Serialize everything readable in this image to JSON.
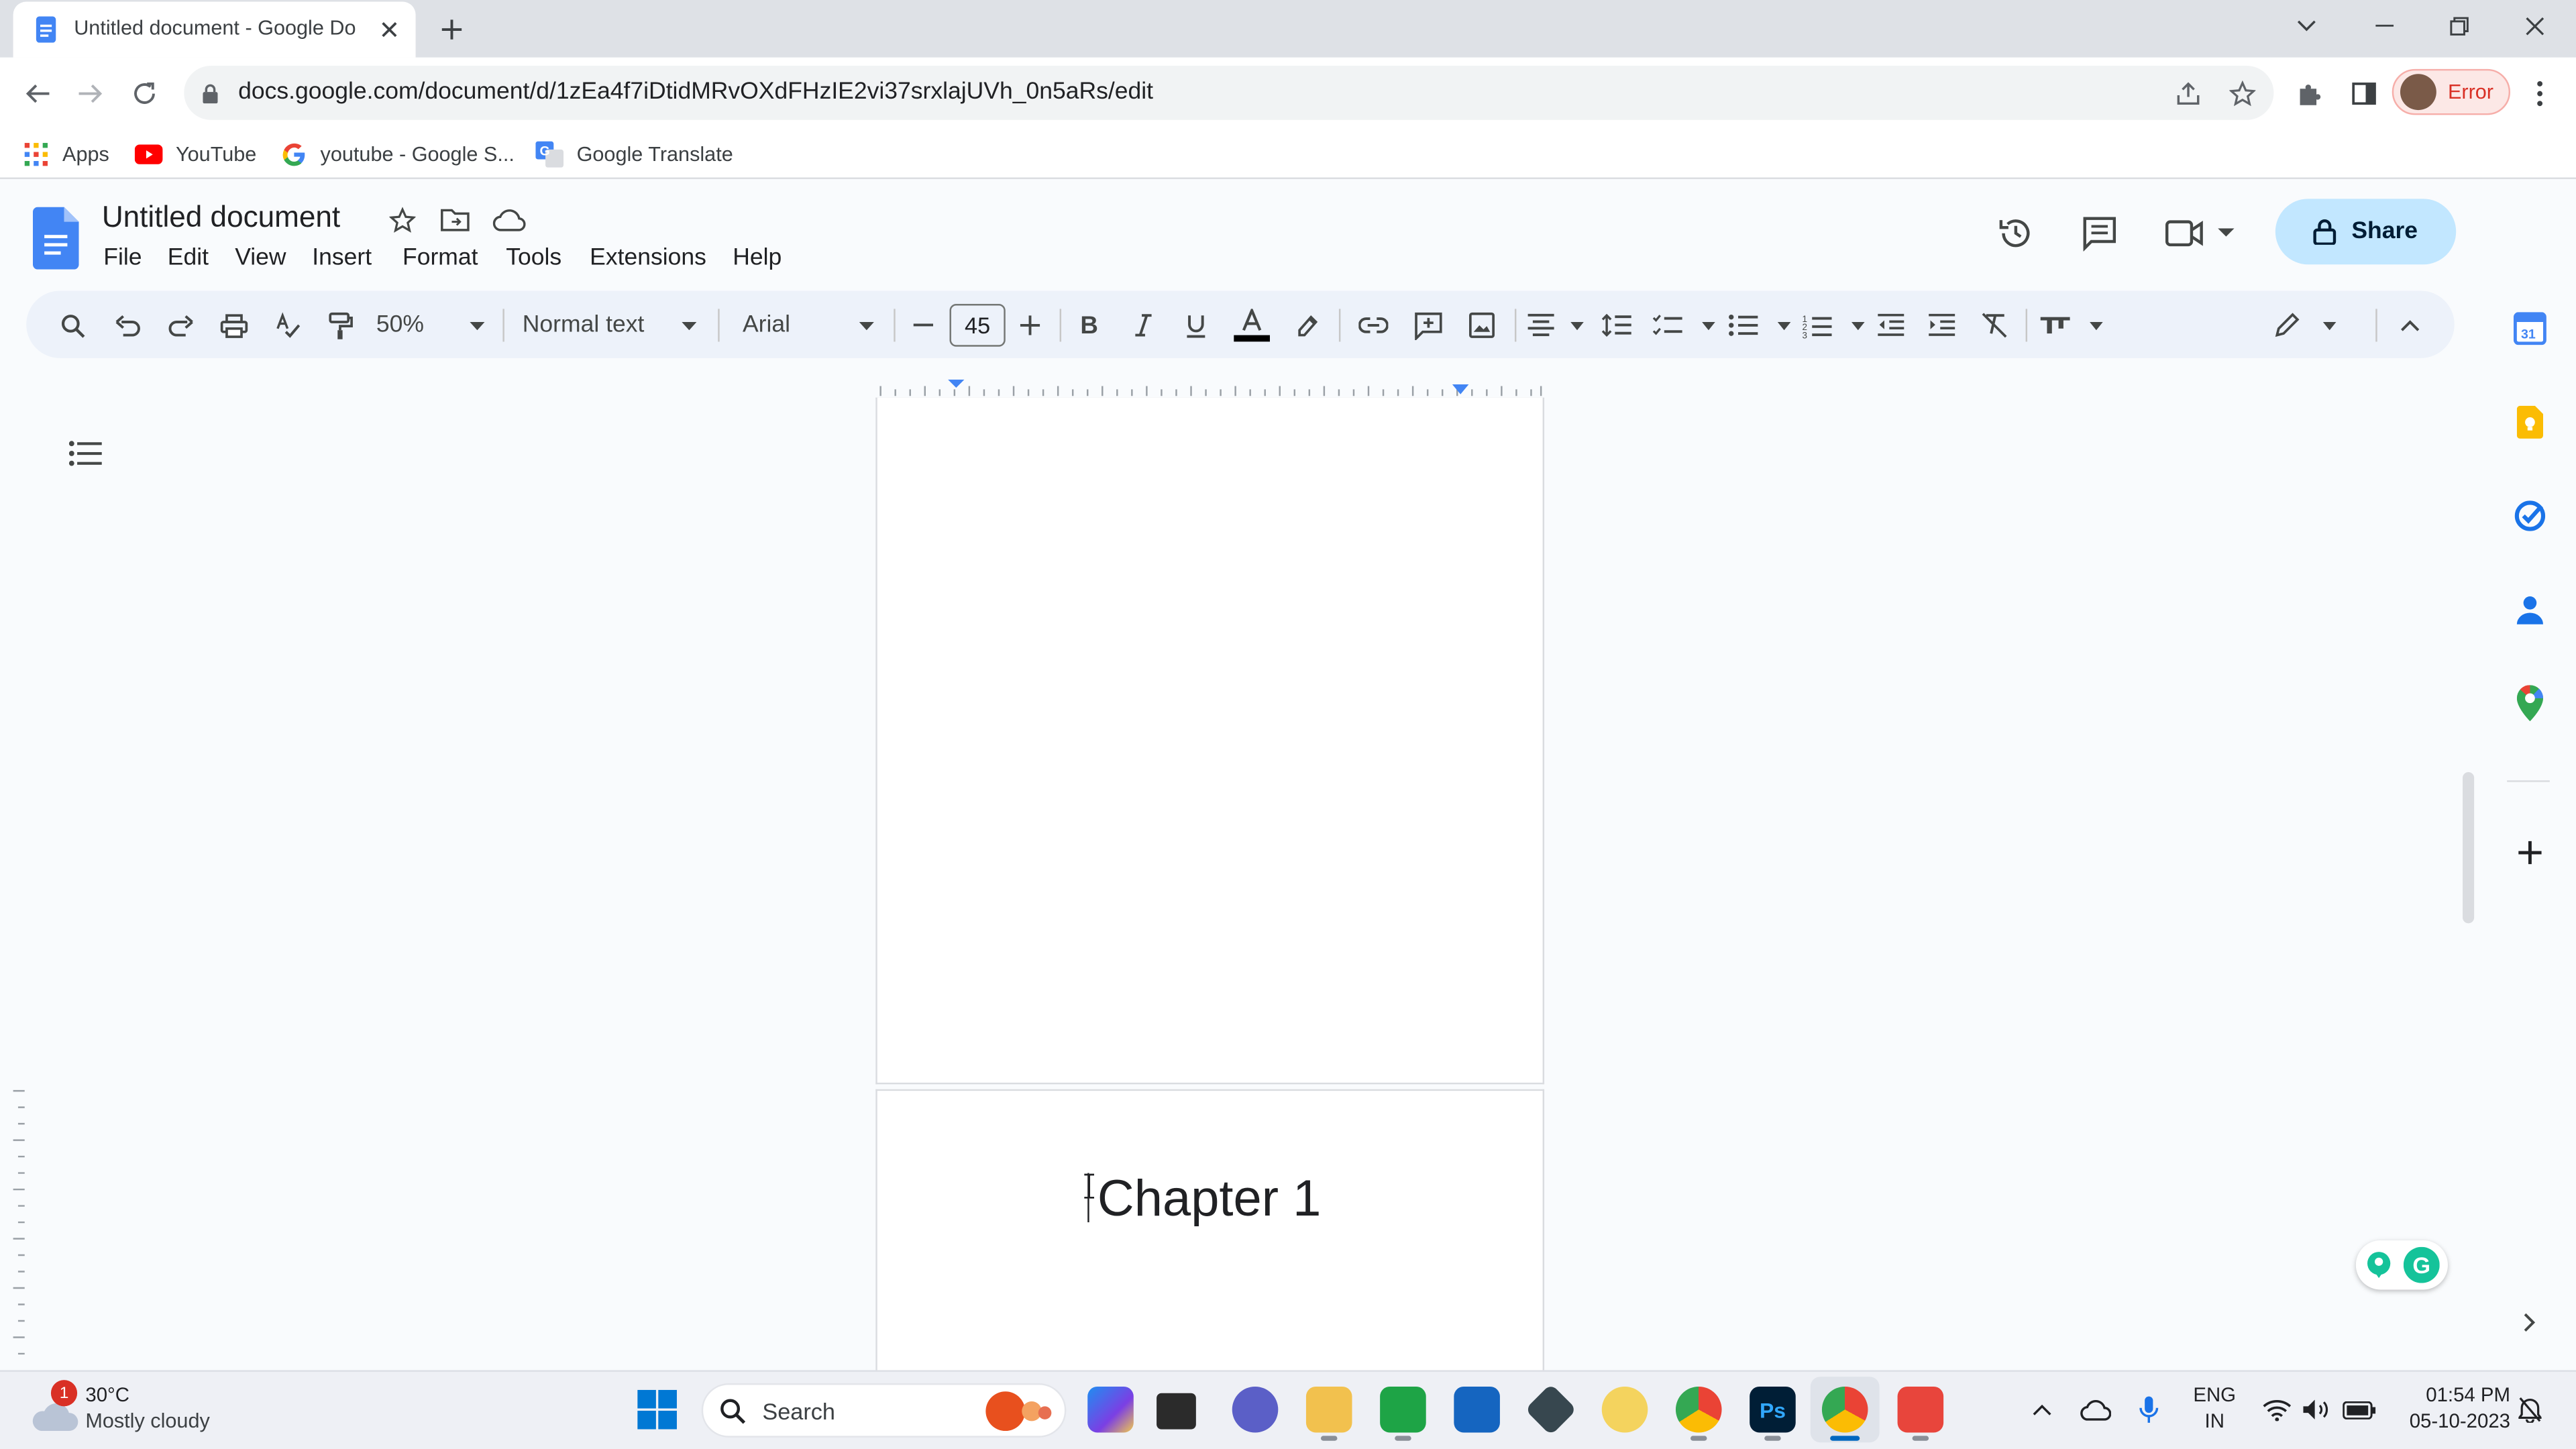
{
  "browser": {
    "tab_title": "Untitled document - Google Do",
    "url": "docs.google.com/document/d/1zEa4f7iDtidMRvOXdFHzIE2vi37srxlajUVh_0n5aRs/edit",
    "profile_label": "Error",
    "bookmarks": [
      "Apps",
      "YouTube",
      "youtube - Google S...",
      "Google Translate"
    ]
  },
  "docs": {
    "title": "Untitled document",
    "menus": [
      "File",
      "Edit",
      "View",
      "Insert",
      "Format",
      "Tools",
      "Extensions",
      "Help"
    ],
    "share_label": "Share",
    "toolbar": {
      "zoom": "50%",
      "style": "Normal text",
      "font": "Arial",
      "font_size": "45"
    },
    "content": {
      "page2_text": "Chapter 1"
    }
  },
  "taskbar": {
    "weather_temp": "30°C",
    "weather_desc": "Mostly cloudy",
    "weather_badge": "1",
    "search_label": "Search",
    "lang_line1": "ENG",
    "lang_line2": "IN",
    "time": "01:54 PM",
    "date": "05-10-2023"
  },
  "colors": {
    "docs_blue": "#4285f4",
    "share_bg": "#c2e7ff",
    "error_red": "#d93025"
  }
}
